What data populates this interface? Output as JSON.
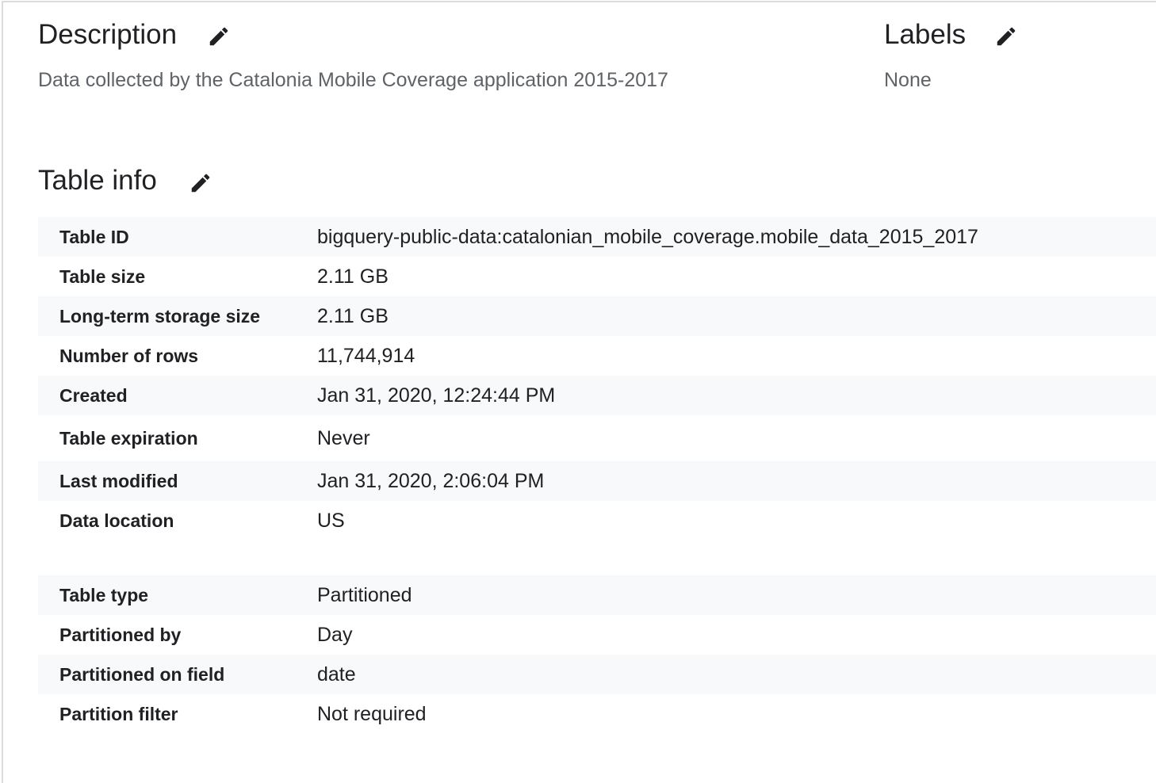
{
  "description": {
    "title": "Description",
    "text": "Data collected by the Catalonia Mobile Coverage application 2015-2017"
  },
  "labels": {
    "title": "Labels",
    "text": "None"
  },
  "table_info": {
    "title": "Table info",
    "group1": [
      {
        "key": "Table ID",
        "value": "bigquery-public-data:catalonian_mobile_coverage.mobile_data_2015_2017"
      },
      {
        "key": "Table size",
        "value": "2.11 GB"
      },
      {
        "key": "Long-term storage size",
        "value": "2.11 GB"
      },
      {
        "key": "Number of rows",
        "value": "11,744,914"
      },
      {
        "key": "Created",
        "value": "Jan 31, 2020, 12:24:44 PM"
      },
      {
        "key": "Table expiration",
        "value": "Never"
      },
      {
        "key": "Last modified",
        "value": "Jan 31, 2020, 2:06:04 PM"
      },
      {
        "key": "Data location",
        "value": "US"
      }
    ],
    "group2": [
      {
        "key": "Table type",
        "value": "Partitioned"
      },
      {
        "key": "Partitioned by",
        "value": "Day"
      },
      {
        "key": "Partitioned on field",
        "value": "date"
      },
      {
        "key": "Partition filter",
        "value": "Not required"
      }
    ]
  },
  "icons": {
    "edit": "pencil-icon"
  },
  "colors": {
    "row_shade": "#f8f9fa",
    "heading": "#202124",
    "muted": "#5f6368",
    "border": "#dadce0"
  }
}
